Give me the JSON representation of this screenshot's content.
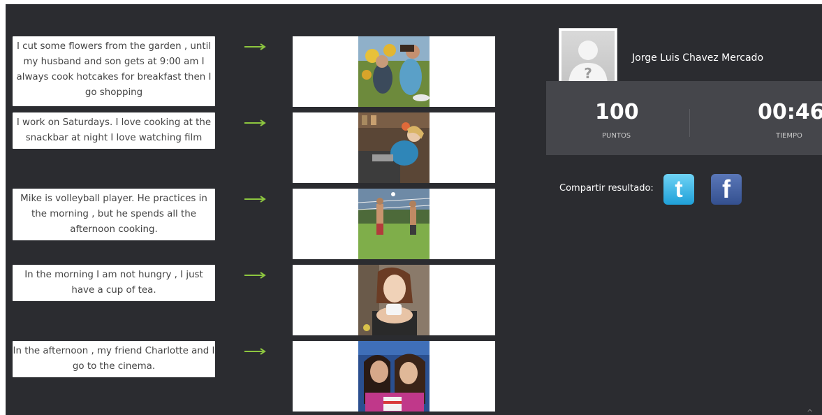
{
  "items": [
    {
      "sentence": "I cut some flowers from the garden , until my husband and son gets at 9:00 am I always cook hotcakes for breakfast then I go shopping",
      "photo_icon": "women-gardening-photo"
    },
    {
      "sentence": "I work on Saturdays. I love cooking at the snackbar at night I love watching film",
      "photo_icon": "woman-in-kitchen-photo"
    },
    {
      "sentence": "Mike is volleyball player. He practices in the morning , but he spends all the afternoon cooking.",
      "photo_icon": "beach-volleyball-photo"
    },
    {
      "sentence": "In the morning I am not hungry , I just have a cup of tea.",
      "photo_icon": "woman-drinking-tea-photo"
    },
    {
      "sentence": "In the afternoon , my friend Charlotte and I go to the cinema.",
      "photo_icon": "friends-at-cinema-photo"
    }
  ],
  "user": {
    "name": "Jorge Luis Chavez Mercado",
    "avatar_icon": "default-avatar-icon"
  },
  "stats": {
    "points_value": "100",
    "points_label": "PUNTOS",
    "time_value": "00:46",
    "time_label": "TIEMPO"
  },
  "share": {
    "label": "Compartir resultado:",
    "twitter_glyph": "t",
    "facebook_glyph": "f"
  },
  "colors": {
    "arrow": "#8dc63f",
    "background": "#2b2c30",
    "stats_bg": "#45464b"
  }
}
